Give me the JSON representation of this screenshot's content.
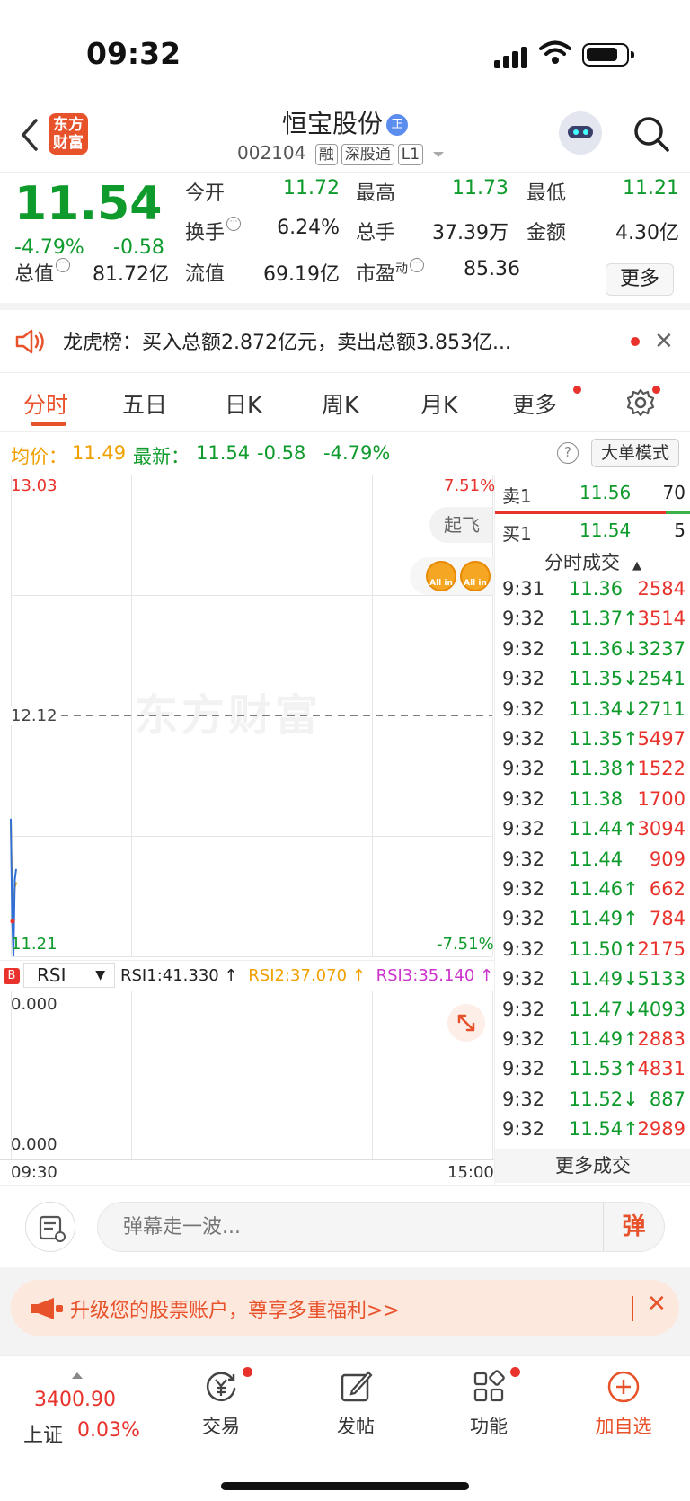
{
  "status": {
    "time": "09:32"
  },
  "header": {
    "logo_line1": "东方",
    "logo_line2": "财富",
    "stock_name": "恒宝股份",
    "badge": "正",
    "code": "002104",
    "tags": [
      "融",
      "深股通",
      "L1"
    ]
  },
  "quote": {
    "price": "11.54",
    "change_pct": "-4.79%",
    "change": "-0.58",
    "open_label": "今开",
    "open": "11.72",
    "high_label": "最高",
    "high": "11.73",
    "low_label": "最低",
    "low": "11.21",
    "turnover_label": "换手",
    "turnover": "6.24%",
    "volume_label": "总手",
    "volume": "37.39万",
    "amount_label": "金额",
    "amount": "4.30亿",
    "mcap_label": "总值",
    "mcap": "81.72亿",
    "float_label": "流值",
    "float": "69.19亿",
    "pe_label": "市盈",
    "pe_sup": "动",
    "pe": "85.36",
    "more": "更多"
  },
  "dragon": {
    "text": "龙虎榜：买入总额2.872亿元，卖出总额3.853亿..."
  },
  "tabs": [
    {
      "label": "分时"
    },
    {
      "label": "五日"
    },
    {
      "label": "日K"
    },
    {
      "label": "周K"
    },
    {
      "label": "月K"
    },
    {
      "label": "更多"
    }
  ],
  "avgline": {
    "avg_label": "均价：",
    "avg": "11.49",
    "latest_label": "最新：",
    "latest": "11.54",
    "chg": "-0.58",
    "pct": "-4.79%",
    "mode": "大单模式",
    "help": "?"
  },
  "chart": {
    "top_price": "13.03",
    "top_pct": "7.51%",
    "mid_price": "12.12",
    "bottom_price": "11.21",
    "bottom_pct": "-7.51%",
    "watermark": "东方财富",
    "qifei": "起飞",
    "allin": "All in",
    "colors": {
      "price_line": "#2f6fd6",
      "avg_line": "#f0a000"
    }
  },
  "rsi": {
    "badge": "B",
    "selector": "RSI",
    "rsi1": "RSI1:41.330 ↑",
    "rsi2": "RSI2:37.070 ↑",
    "rsi3": "RSI3:35.140 ↑",
    "top": "0.000",
    "bottom": "0.000"
  },
  "xaxis": {
    "start": "09:30",
    "end": "15:00"
  },
  "book": {
    "sell_label": "卖1",
    "sell_price": "11.56",
    "sell_vol": "70",
    "buy_label": "买1",
    "buy_price": "11.54",
    "buy_vol": "5",
    "trades_title": "分时成交",
    "trades": [
      {
        "t": "9:31",
        "p": "11.36",
        "v": "2584",
        "pc": "green",
        "vc": "red"
      },
      {
        "t": "9:32",
        "p": "11.37↑",
        "v": "3514",
        "pc": "green",
        "vc": "red"
      },
      {
        "t": "9:32",
        "p": "11.36↓",
        "v": "3237",
        "pc": "green",
        "vc": "green"
      },
      {
        "t": "9:32",
        "p": "11.35↓",
        "v": "2541",
        "pc": "green",
        "vc": "green"
      },
      {
        "t": "9:32",
        "p": "11.34↓",
        "v": "2711",
        "pc": "green",
        "vc": "green"
      },
      {
        "t": "9:32",
        "p": "11.35↑",
        "v": "5497",
        "pc": "green",
        "vc": "red"
      },
      {
        "t": "9:32",
        "p": "11.38↑",
        "v": "1522",
        "pc": "green",
        "vc": "red"
      },
      {
        "t": "9:32",
        "p": "11.38",
        "v": "1700",
        "pc": "green",
        "vc": "red"
      },
      {
        "t": "9:32",
        "p": "11.44↑",
        "v": "3094",
        "pc": "green",
        "vc": "red"
      },
      {
        "t": "9:32",
        "p": "11.44",
        "v": "909",
        "pc": "green",
        "vc": "red"
      },
      {
        "t": "9:32",
        "p": "11.46↑",
        "v": "662",
        "pc": "green",
        "vc": "red"
      },
      {
        "t": "9:32",
        "p": "11.49↑",
        "v": "784",
        "pc": "green",
        "vc": "red"
      },
      {
        "t": "9:32",
        "p": "11.50↑",
        "v": "2175",
        "pc": "green",
        "vc": "red"
      },
      {
        "t": "9:32",
        "p": "11.49↓",
        "v": "5133",
        "pc": "green",
        "vc": "green"
      },
      {
        "t": "9:32",
        "p": "11.47↓",
        "v": "4093",
        "pc": "green",
        "vc": "green"
      },
      {
        "t": "9:32",
        "p": "11.49↑",
        "v": "2883",
        "pc": "green",
        "vc": "red"
      },
      {
        "t": "9:32",
        "p": "11.53↑",
        "v": "4831",
        "pc": "green",
        "vc": "red"
      },
      {
        "t": "9:32",
        "p": "11.52↓",
        "v": "887",
        "pc": "green",
        "vc": "green"
      },
      {
        "t": "9:32",
        "p": "11.54↑",
        "v": "2989",
        "pc": "green",
        "vc": "red"
      }
    ],
    "more_trades": "更多成交"
  },
  "comment": {
    "placeholder": "弹幕走一波...",
    "button": "弹"
  },
  "promo": {
    "text": "升级您的股票账户，尊享多重福利>>"
  },
  "bottomnav": {
    "index_value": "3400.90",
    "index_name": "上证",
    "index_pct": "0.03%",
    "items": [
      {
        "label": "交易"
      },
      {
        "label": "发帖"
      },
      {
        "label": "功能"
      },
      {
        "label": "加自选"
      }
    ]
  }
}
